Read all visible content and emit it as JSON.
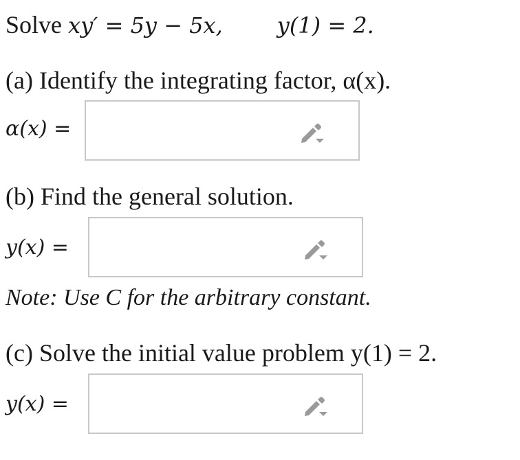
{
  "problem": {
    "prefix": "Solve",
    "equation": "xy′ = 5y − 5x,",
    "initial_condition": "y(1) = 2."
  },
  "parts": [
    {
      "prompt": "(a) Identify the integrating factor, α(x).",
      "answer_label": "α(x) =",
      "answer_value": "",
      "icon": "pencil-dropdown-icon"
    },
    {
      "prompt": "(b) Find the general solution.",
      "answer_label": "y(x) =",
      "answer_value": "",
      "icon": "pencil-dropdown-icon",
      "note": "Note: Use C for the arbitrary constant."
    },
    {
      "prompt": "(c) Solve the initial value problem y(1) = 2.",
      "answer_label": "y(x) =",
      "answer_value": "",
      "icon": "pencil-dropdown-icon"
    }
  ],
  "colors": {
    "box_border": "#c8c8c8",
    "icon": "#9a9a9a",
    "text": "#1a1a1a"
  }
}
